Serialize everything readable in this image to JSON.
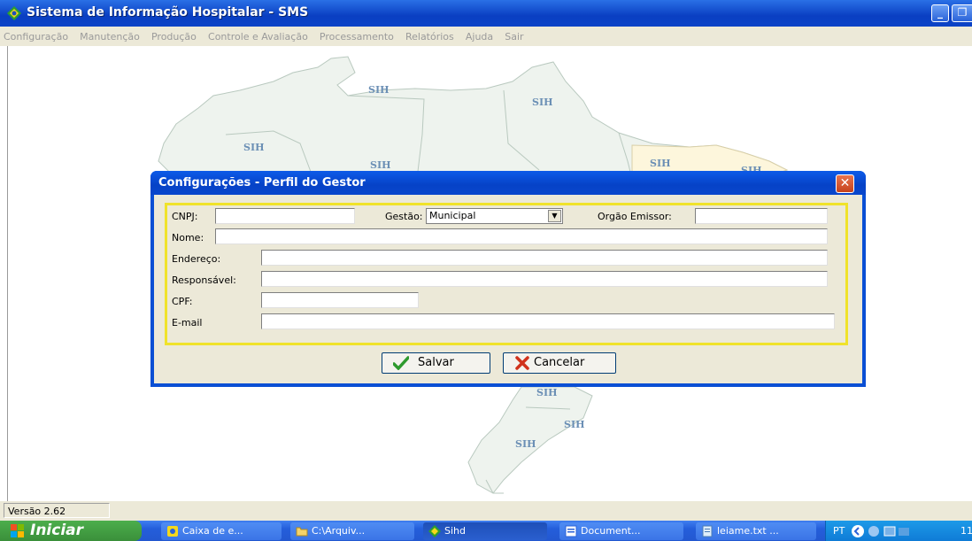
{
  "window": {
    "title": "Sistema de Informação Hospitalar - SMS",
    "minimize_glyph": "_",
    "restore_glyph": "❐"
  },
  "menu": {
    "items": [
      "Configuração",
      "Manutenção",
      "Produção",
      "Controle e Avaliação",
      "Processamento",
      "Relatórios",
      "Ajuda",
      "Sair"
    ]
  },
  "map": {
    "labels": [
      "SIH",
      "SIH",
      "SIH",
      "SIH",
      "SIH",
      "SIH",
      "SIH",
      "SIH",
      "SIH"
    ]
  },
  "dialog": {
    "title": "Configurações - Perfil do Gestor",
    "close_glyph": "✕",
    "fields": {
      "cnpj_label": "CNPJ:",
      "cnpj_value": "",
      "gestao_label": "Gestão:",
      "gestao_value": "Municipal",
      "orgao_label": "Orgão Emissor:",
      "orgao_value": "",
      "nome_label": "Nome:",
      "nome_value": "",
      "endereco_label": "Endereço:",
      "endereco_value": "",
      "responsavel_label": "Responsável:",
      "responsavel_value": "",
      "cpf_label": "CPF:",
      "cpf_value": "",
      "email_label": "E-mail",
      "email_value": ""
    },
    "buttons": {
      "save_label": "Salvar",
      "cancel_label": "Cancelar"
    }
  },
  "status": {
    "version": "Versão 2.62"
  },
  "taskbar": {
    "start_label": "Iniciar",
    "tasks": [
      "Caixa de e...",
      "C:\\Arquiv...",
      "Sihd",
      "Document...",
      "leiame.txt ..."
    ],
    "tray_lang": "PT",
    "tray_clock": "11"
  },
  "colors": {
    "titlebar": "#0a3fc2",
    "dialog_frame": "#f0e22a",
    "map_fill": "#e9f0ea",
    "map_accent": "#fdf4d8",
    "start_button": "#3a8f3a"
  }
}
